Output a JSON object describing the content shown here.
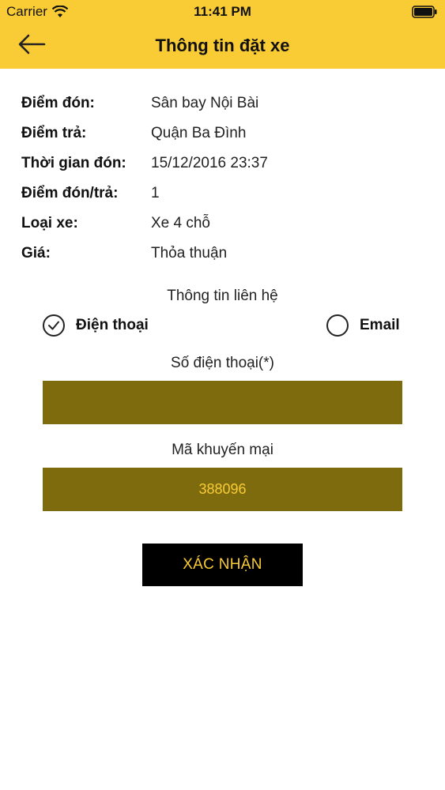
{
  "status_bar": {
    "carrier": "Carrier",
    "time": "11:41 PM"
  },
  "nav": {
    "back_icon": "arrow-left-icon",
    "title": "Thông tin đặt xe"
  },
  "details": [
    {
      "label": "Điểm đón:",
      "value": "Sân bay Nội Bài"
    },
    {
      "label": "Điểm trả:",
      "value": "Quận Ba Đình"
    },
    {
      "label": "Thời gian đón:",
      "value": "15/12/2016 23:37"
    },
    {
      "label": "Điểm đón/trả:",
      "value": "1"
    },
    {
      "label": "Loại xe:",
      "value": "Xe 4 chỗ"
    },
    {
      "label": "Giá:",
      "value": "Thỏa thuận"
    }
  ],
  "contact": {
    "title": "Thông tin liên hệ",
    "options": [
      {
        "label": "Điện thoại",
        "selected": true
      },
      {
        "label": "Email",
        "selected": false
      }
    ]
  },
  "form": {
    "phone_label": "Số điện thoại(*)",
    "phone_value": "",
    "promo_label": "Mã khuyến mại",
    "promo_value": "388096"
  },
  "confirm_label": "XÁC NHẬN",
  "colors": {
    "accent": "#f9cb35",
    "input_bg": "#7d6b0e",
    "button_bg": "#000000"
  }
}
